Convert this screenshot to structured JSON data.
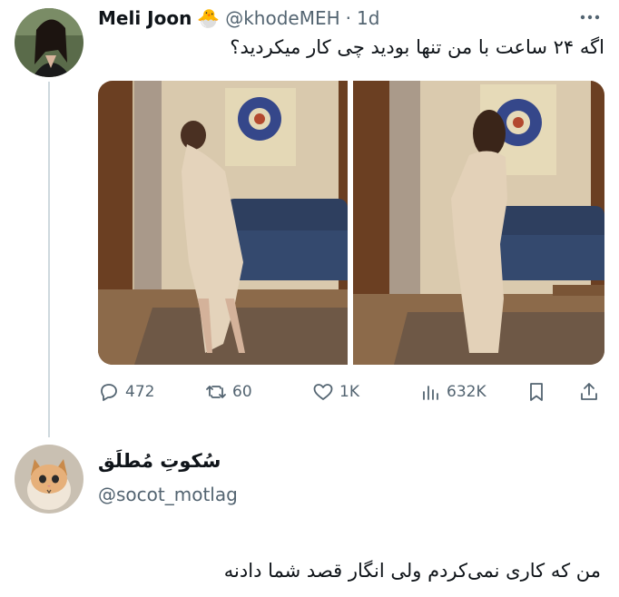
{
  "tweet": {
    "author_name": "Meli Joon",
    "author_emoji": "🐣",
    "handle": "@khodeMEH",
    "separator": "·",
    "time": "1d",
    "text": "اگه ۲۴ ساعت با من تنها بودید چی کار میکردید؟",
    "actions": {
      "replies": "472",
      "retweets": "60",
      "likes": "1K",
      "views": "632K"
    }
  },
  "reply": {
    "author_name": "سُکوتِ مُطلَق",
    "handle": "@socot_motlag",
    "text": "من که کاری نمی‌کردم ولی انگار قصد شما دادنه"
  },
  "colors": {
    "text": "#0f1419",
    "secondary": "#536471",
    "line": "#cfd9de"
  }
}
